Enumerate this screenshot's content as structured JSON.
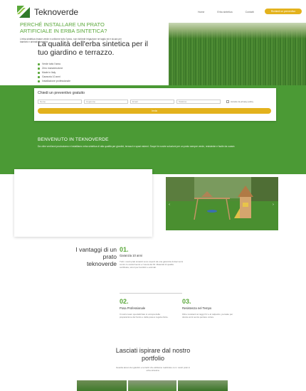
{
  "header": {
    "brand": "Teknoverde",
    "nav": [
      "Home",
      "Erba sintetica",
      "Contatti"
    ],
    "cta_label": "Richiedi un preventivo"
  },
  "hero": {
    "title": "La qualità dell'erba sintetica per il tuo giardino e terrazzo.",
    "features": [
      "Verde tutto l'anno",
      "Zero manutenzione",
      "Made in Italy",
      "Garanzia 10 anni",
      "Installazione professionale"
    ]
  },
  "quote_form": {
    "title": "Chiedi un preventivo gratuito",
    "fields": [
      "Nome",
      "Cognome",
      "Email",
      "Telefono"
    ],
    "privacy_label": "Accetto la privacy policy",
    "submit_label": "Invia"
  },
  "welcome": {
    "title": "BENVENUTO IN TEKNOVERDE",
    "text": "Da oltre vent'anni produciamo e installiamo erba sintetica di alta qualità per giardini, terrazzi e spazi esterni. Scopri le nostre soluzioni per un prato sempre verde, resistente e facile da curare."
  },
  "why": {
    "title": "PERCHÉ INSTALLARE UN PRATO ARTIFICIALE IN ERBA SINTETICA?",
    "text": "L'erba sintetica rimane verde e uniforme tutto l'anno, non richiede irrigazione né taglio ed è sicura per bambini e animali domestici."
  },
  "advantages": {
    "title": "I vantaggi di un prato teknoverde",
    "items": [
      {
        "num": "01.",
        "title": "Garanzia 10 anni",
        "text": "Tutti i nostri prati sintetici sono coperti da una garanzia di dieci anni contro lo scolorimento e l'usura dei fili. Materiali di qualità certificata, sicuri per bambini e animali."
      },
      {
        "num": "02.",
        "title": "Posa Professionale",
        "text": "Il nostro team specializzato si occupa della preparazione del fondo e della posa a regola d'arte."
      },
      {
        "num": "03.",
        "title": "Resistenza nel Tempo",
        "text": "Fibre resistenti ai raggi UV e al calpestio, pensate per durare anni senza perdere colore."
      }
    ]
  },
  "portfolio": {
    "title": "Lasciati ispirare dal nostro portfolio",
    "text": "Guarda alcuni dei giardini e terrazzi che abbiamo realizzato con i nostri prati in erba sintetica."
  },
  "colors": {
    "brand_green": "#4b9a35",
    "accent_yellow": "#e3b21d"
  }
}
